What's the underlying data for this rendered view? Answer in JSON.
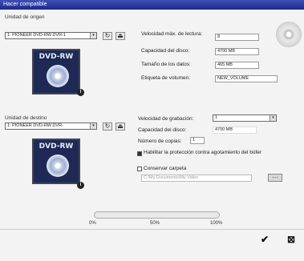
{
  "window": {
    "title": "Hacer compatible"
  },
  "source": {
    "section_label": "Unidad de origen",
    "drive": "1: PIONEER DVD-RW  DVR-1",
    "speed_label": "Velocidad máx. de lectura:",
    "speed_value": "8",
    "capacity_label": "Capacidad del disco:",
    "capacity_value": "4700 MB",
    "data_size_label": "Tamaño de los datos:",
    "data_size_value": "465 MB",
    "volume_label": "Etiqueta de volumen:",
    "volume_value": "NEW_VOLUME",
    "media_text": "DVD-RW"
  },
  "destination": {
    "section_label": "Unidad de destino",
    "drive": "1: PIONEER DVD-RW  DVR-",
    "media_text": "DVD-RW",
    "write_speed_label": "Velocidad de grabación:",
    "write_speed_value": "1",
    "capacity_label": "Capacidad del disco:",
    "capacity_value": "4700 MB",
    "copies_label": "Número de copias:",
    "copies_value": "1",
    "buffer_label": "Habilitar la protección contra agotamiento del búfer",
    "buffer_checked": true,
    "keep_folder_label": "Conservar carpeta",
    "keep_folder_checked": false,
    "folder_path": "C:\\My Documents\\My Video"
  },
  "progress": {
    "value": 0,
    "ticks": [
      "0%",
      "50%",
      "100%"
    ]
  },
  "icons": {
    "eject": "eject-icon",
    "refresh": "refresh-icon",
    "info": "info-icon",
    "ok": "checkmark-icon",
    "cancel": "cancel-icon"
  }
}
